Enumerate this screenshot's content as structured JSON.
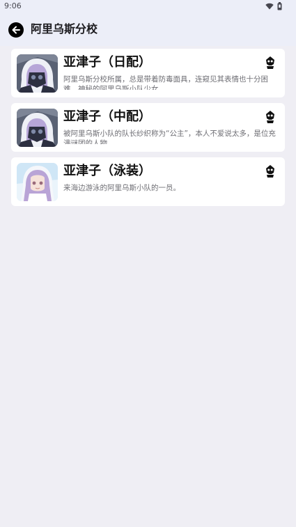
{
  "status_bar": {
    "time": "9:06",
    "icons": [
      "wifi-icon",
      "battery-icon"
    ]
  },
  "app_bar": {
    "back_icon": "arrow-back-icon",
    "title": "阿里乌斯分校"
  },
  "students": [
    {
      "name": "亚津子（日配）",
      "description": "阿里乌斯分校所属，总是带着防毒面具，连窥见其表情也十分困难，神秘的阿里乌斯小队少女。",
      "avatar_icon": "character-portrait-hooded",
      "type_icon": "skull-emblem-icon"
    },
    {
      "name": "亚津子（中配）",
      "description": "被阿里乌斯小队的队长纱织称为“公主”，本人不爱说太多，是位充满谜团的人物。",
      "avatar_icon": "character-portrait-hooded",
      "type_icon": "skull-emblem-icon"
    },
    {
      "name": "亚津子（泳装）",
      "description": "来海边游泳的阿里乌斯小队的一员。",
      "avatar_icon": "character-portrait-swimsuit",
      "type_icon": "skull-emblem-icon"
    }
  ],
  "colors": {
    "background": "#efeef4",
    "app_bar": "#eceef8",
    "card": "#ffffff",
    "title_text": "#1c1b1f",
    "desc_text": "#6f6f75"
  }
}
